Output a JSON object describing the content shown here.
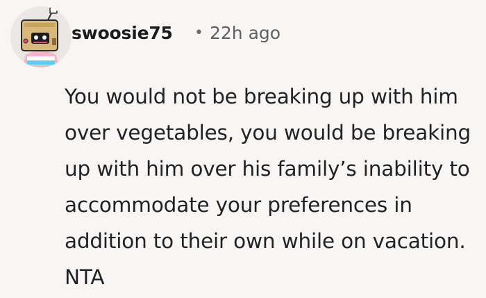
{
  "comment": {
    "username": "swoosie75",
    "separator": "•",
    "timestamp": "22h ago",
    "text": "You would not be breaking up with him over vegetables, you would be breaking up with him over his family’s inability to accommodate your preferences in addition to their own while on vacation. NTA",
    "avatar_icon": "snoo-avatar-icon"
  }
}
